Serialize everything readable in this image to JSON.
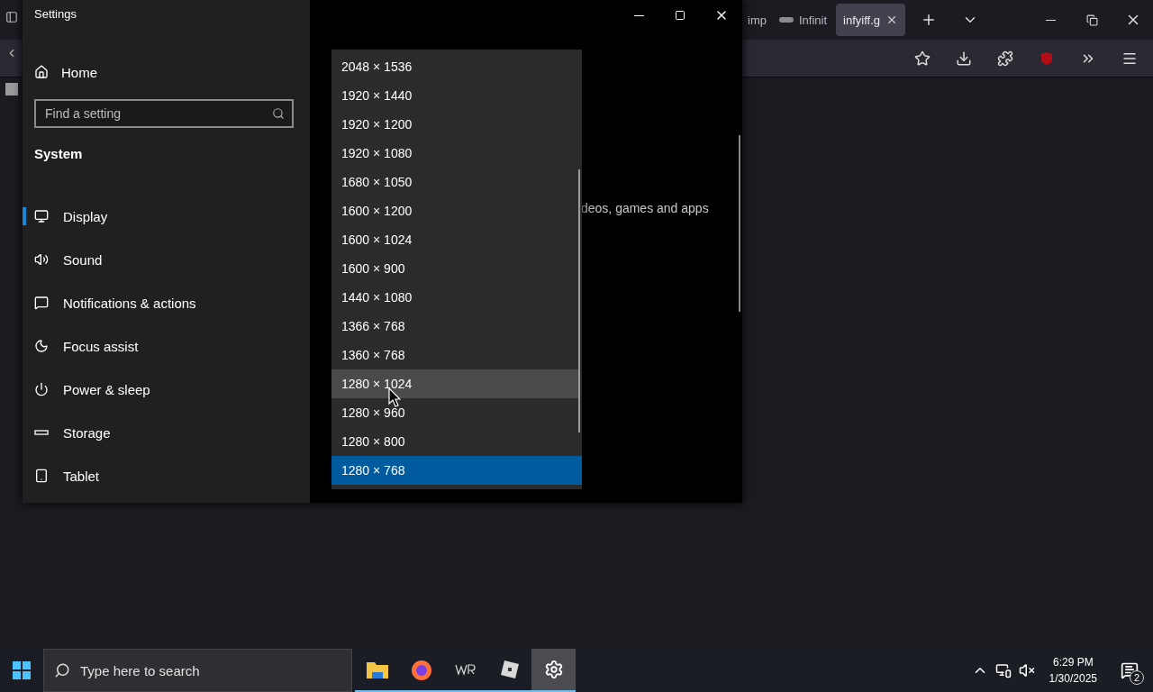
{
  "browser": {
    "tabs": [
      {
        "label": "imp",
        "selected": false,
        "kind": "plain"
      },
      {
        "label": "Infinit",
        "selected": false,
        "kind": "favicon"
      },
      {
        "label": "infyiff.g",
        "selected": true,
        "kind": "plain"
      }
    ]
  },
  "settings": {
    "title": "Settings",
    "home": "Home",
    "search": {
      "placeholder": "Find a setting"
    },
    "section": "System",
    "nav": [
      {
        "label": "Display",
        "kind": "display",
        "selected": true
      },
      {
        "label": "Sound",
        "kind": "sound",
        "selected": false
      },
      {
        "label": "Notifications & actions",
        "kind": "notifications",
        "selected": false
      },
      {
        "label": "Focus assist",
        "kind": "focus",
        "selected": false
      },
      {
        "label": "Power & sleep",
        "kind": "power",
        "selected": false
      },
      {
        "label": "Storage",
        "kind": "storage",
        "selected": false
      },
      {
        "label": "Tablet",
        "kind": "tablet",
        "selected": false
      }
    ],
    "content_text": "deos, games and apps",
    "resolutions": [
      {
        "label": "2048 × 1536",
        "selected": false,
        "hovered": false
      },
      {
        "label": "1920 × 1440",
        "selected": false,
        "hovered": false
      },
      {
        "label": "1920 × 1200",
        "selected": false,
        "hovered": false
      },
      {
        "label": "1920 × 1080",
        "selected": false,
        "hovered": false
      },
      {
        "label": "1680 × 1050",
        "selected": false,
        "hovered": false
      },
      {
        "label": "1600 × 1200",
        "selected": false,
        "hovered": false
      },
      {
        "label": "1600 × 1024",
        "selected": false,
        "hovered": false
      },
      {
        "label": "1600 × 900",
        "selected": false,
        "hovered": false
      },
      {
        "label": "1440 × 1080",
        "selected": false,
        "hovered": false
      },
      {
        "label": "1366 × 768",
        "selected": false,
        "hovered": false
      },
      {
        "label": "1360 × 768",
        "selected": false,
        "hovered": false
      },
      {
        "label": "1280 × 1024",
        "selected": false,
        "hovered": true
      },
      {
        "label": "1280 × 960",
        "selected": false,
        "hovered": false
      },
      {
        "label": "1280 × 800",
        "selected": false,
        "hovered": false
      },
      {
        "label": "1280 × 768",
        "selected": true,
        "hovered": false
      }
    ]
  },
  "taskbar": {
    "search": {
      "placeholder": "Type here to search"
    },
    "apps": [
      {
        "kind": "files",
        "running": true,
        "selected": false
      },
      {
        "kind": "firefox",
        "running": true,
        "selected": false
      },
      {
        "kind": "wrd",
        "running": true,
        "selected": false
      },
      {
        "kind": "cube",
        "running": true,
        "selected": false
      },
      {
        "kind": "settings",
        "running": true,
        "selected": true
      }
    ],
    "time": "6:29 PM",
    "date": "1/30/2025",
    "notifications": "2"
  }
}
